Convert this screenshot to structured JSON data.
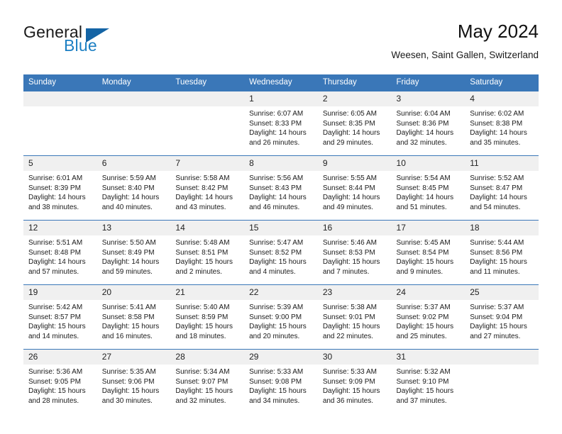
{
  "logo": {
    "word_general": "General",
    "word_blue": "Blue",
    "triangle_color": "#1464a5",
    "blue_color": "#1c7fc3"
  },
  "header": {
    "title": "May 2024",
    "subtitle": "Weesen, Saint Gallen, Switzerland",
    "accent_color": "#3a77b8"
  },
  "weekdays": [
    "Sunday",
    "Monday",
    "Tuesday",
    "Wednesday",
    "Thursday",
    "Friday",
    "Saturday"
  ],
  "weeks": [
    [
      {
        "day": "",
        "sunrise": "",
        "sunset": "",
        "daylight": ""
      },
      {
        "day": "",
        "sunrise": "",
        "sunset": "",
        "daylight": ""
      },
      {
        "day": "",
        "sunrise": "",
        "sunset": "",
        "daylight": ""
      },
      {
        "day": "1",
        "sunrise": "Sunrise: 6:07 AM",
        "sunset": "Sunset: 8:33 PM",
        "daylight": "Daylight: 14 hours and 26 minutes."
      },
      {
        "day": "2",
        "sunrise": "Sunrise: 6:05 AM",
        "sunset": "Sunset: 8:35 PM",
        "daylight": "Daylight: 14 hours and 29 minutes."
      },
      {
        "day": "3",
        "sunrise": "Sunrise: 6:04 AM",
        "sunset": "Sunset: 8:36 PM",
        "daylight": "Daylight: 14 hours and 32 minutes."
      },
      {
        "day": "4",
        "sunrise": "Sunrise: 6:02 AM",
        "sunset": "Sunset: 8:38 PM",
        "daylight": "Daylight: 14 hours and 35 minutes."
      }
    ],
    [
      {
        "day": "5",
        "sunrise": "Sunrise: 6:01 AM",
        "sunset": "Sunset: 8:39 PM",
        "daylight": "Daylight: 14 hours and 38 minutes."
      },
      {
        "day": "6",
        "sunrise": "Sunrise: 5:59 AM",
        "sunset": "Sunset: 8:40 PM",
        "daylight": "Daylight: 14 hours and 40 minutes."
      },
      {
        "day": "7",
        "sunrise": "Sunrise: 5:58 AM",
        "sunset": "Sunset: 8:42 PM",
        "daylight": "Daylight: 14 hours and 43 minutes."
      },
      {
        "day": "8",
        "sunrise": "Sunrise: 5:56 AM",
        "sunset": "Sunset: 8:43 PM",
        "daylight": "Daylight: 14 hours and 46 minutes."
      },
      {
        "day": "9",
        "sunrise": "Sunrise: 5:55 AM",
        "sunset": "Sunset: 8:44 PM",
        "daylight": "Daylight: 14 hours and 49 minutes."
      },
      {
        "day": "10",
        "sunrise": "Sunrise: 5:54 AM",
        "sunset": "Sunset: 8:45 PM",
        "daylight": "Daylight: 14 hours and 51 minutes."
      },
      {
        "day": "11",
        "sunrise": "Sunrise: 5:52 AM",
        "sunset": "Sunset: 8:47 PM",
        "daylight": "Daylight: 14 hours and 54 minutes."
      }
    ],
    [
      {
        "day": "12",
        "sunrise": "Sunrise: 5:51 AM",
        "sunset": "Sunset: 8:48 PM",
        "daylight": "Daylight: 14 hours and 57 minutes."
      },
      {
        "day": "13",
        "sunrise": "Sunrise: 5:50 AM",
        "sunset": "Sunset: 8:49 PM",
        "daylight": "Daylight: 14 hours and 59 minutes."
      },
      {
        "day": "14",
        "sunrise": "Sunrise: 5:48 AM",
        "sunset": "Sunset: 8:51 PM",
        "daylight": "Daylight: 15 hours and 2 minutes."
      },
      {
        "day": "15",
        "sunrise": "Sunrise: 5:47 AM",
        "sunset": "Sunset: 8:52 PM",
        "daylight": "Daylight: 15 hours and 4 minutes."
      },
      {
        "day": "16",
        "sunrise": "Sunrise: 5:46 AM",
        "sunset": "Sunset: 8:53 PM",
        "daylight": "Daylight: 15 hours and 7 minutes."
      },
      {
        "day": "17",
        "sunrise": "Sunrise: 5:45 AM",
        "sunset": "Sunset: 8:54 PM",
        "daylight": "Daylight: 15 hours and 9 minutes."
      },
      {
        "day": "18",
        "sunrise": "Sunrise: 5:44 AM",
        "sunset": "Sunset: 8:56 PM",
        "daylight": "Daylight: 15 hours and 11 minutes."
      }
    ],
    [
      {
        "day": "19",
        "sunrise": "Sunrise: 5:42 AM",
        "sunset": "Sunset: 8:57 PM",
        "daylight": "Daylight: 15 hours and 14 minutes."
      },
      {
        "day": "20",
        "sunrise": "Sunrise: 5:41 AM",
        "sunset": "Sunset: 8:58 PM",
        "daylight": "Daylight: 15 hours and 16 minutes."
      },
      {
        "day": "21",
        "sunrise": "Sunrise: 5:40 AM",
        "sunset": "Sunset: 8:59 PM",
        "daylight": "Daylight: 15 hours and 18 minutes."
      },
      {
        "day": "22",
        "sunrise": "Sunrise: 5:39 AM",
        "sunset": "Sunset: 9:00 PM",
        "daylight": "Daylight: 15 hours and 20 minutes."
      },
      {
        "day": "23",
        "sunrise": "Sunrise: 5:38 AM",
        "sunset": "Sunset: 9:01 PM",
        "daylight": "Daylight: 15 hours and 22 minutes."
      },
      {
        "day": "24",
        "sunrise": "Sunrise: 5:37 AM",
        "sunset": "Sunset: 9:02 PM",
        "daylight": "Daylight: 15 hours and 25 minutes."
      },
      {
        "day": "25",
        "sunrise": "Sunrise: 5:37 AM",
        "sunset": "Sunset: 9:04 PM",
        "daylight": "Daylight: 15 hours and 27 minutes."
      }
    ],
    [
      {
        "day": "26",
        "sunrise": "Sunrise: 5:36 AM",
        "sunset": "Sunset: 9:05 PM",
        "daylight": "Daylight: 15 hours and 28 minutes."
      },
      {
        "day": "27",
        "sunrise": "Sunrise: 5:35 AM",
        "sunset": "Sunset: 9:06 PM",
        "daylight": "Daylight: 15 hours and 30 minutes."
      },
      {
        "day": "28",
        "sunrise": "Sunrise: 5:34 AM",
        "sunset": "Sunset: 9:07 PM",
        "daylight": "Daylight: 15 hours and 32 minutes."
      },
      {
        "day": "29",
        "sunrise": "Sunrise: 5:33 AM",
        "sunset": "Sunset: 9:08 PM",
        "daylight": "Daylight: 15 hours and 34 minutes."
      },
      {
        "day": "30",
        "sunrise": "Sunrise: 5:33 AM",
        "sunset": "Sunset: 9:09 PM",
        "daylight": "Daylight: 15 hours and 36 minutes."
      },
      {
        "day": "31",
        "sunrise": "Sunrise: 5:32 AM",
        "sunset": "Sunset: 9:10 PM",
        "daylight": "Daylight: 15 hours and 37 minutes."
      },
      {
        "day": "",
        "sunrise": "",
        "sunset": "",
        "daylight": ""
      }
    ]
  ]
}
